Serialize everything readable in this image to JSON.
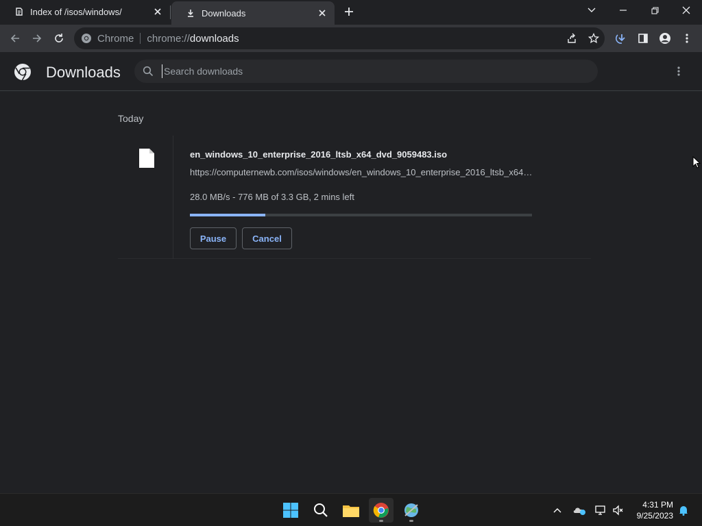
{
  "tabs": [
    {
      "title": "Index of /isos/windows/",
      "icon": "page-icon",
      "active": false
    },
    {
      "title": "Downloads",
      "icon": "download-icon",
      "active": true
    }
  ],
  "omnibox": {
    "site_label": "Chrome",
    "scheme": "chrome://",
    "host": "downloads"
  },
  "header": {
    "title": "Downloads",
    "search_placeholder": "Search downloads"
  },
  "downloads": {
    "section_label": "Today",
    "item": {
      "file_name": "en_windows_10_enterprise_2016_ltsb_x64_dvd_9059483.iso",
      "url": "https://computernewb.com/isos/windows/en_windows_10_enterprise_2016_ltsb_x64_...",
      "status": "28.0 MB/s - 776 MB of 3.3 GB, 2 mins left",
      "progress_fraction": 0.22,
      "pause_label": "Pause",
      "cancel_label": "Cancel"
    }
  },
  "taskbar": {
    "time": "4:31 PM",
    "date": "9/25/2023"
  },
  "colors": {
    "accent": "#8ab4f8",
    "background": "#202124",
    "toolbar": "#35363a"
  }
}
